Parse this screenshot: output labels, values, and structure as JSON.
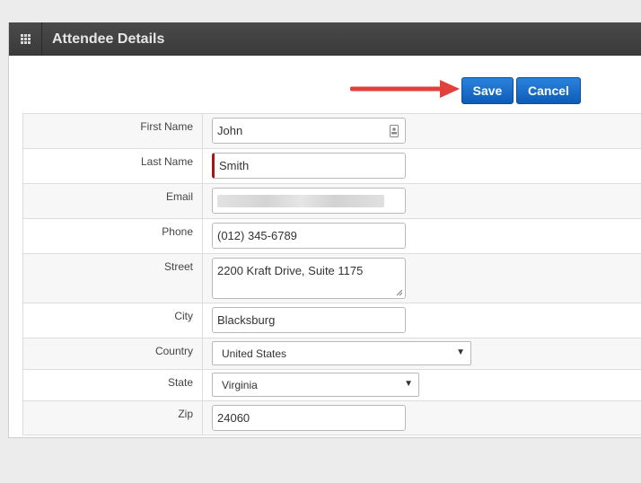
{
  "header": {
    "title": "Attendee Details",
    "icon": "grid-icon"
  },
  "actions": {
    "save_label": "Save",
    "cancel_label": "Cancel"
  },
  "fields": {
    "first_name": {
      "label": "First Name",
      "value": "John"
    },
    "last_name": {
      "label": "Last Name",
      "value": "Smith"
    },
    "email": {
      "label": "Email",
      "value": ""
    },
    "phone": {
      "label": "Phone",
      "value": "(012) 345-6789"
    },
    "street": {
      "label": "Street",
      "value": "2200 Kraft Drive, Suite 1175"
    },
    "city": {
      "label": "City",
      "value": "Blacksburg"
    },
    "country": {
      "label": "Country",
      "value": "United States"
    },
    "state": {
      "label": "State",
      "value": "Virginia"
    },
    "zip": {
      "label": "Zip",
      "value": "24060"
    }
  },
  "colors": {
    "header_bg": "#3f3f3f",
    "button_blue": "#1466c4",
    "arrow_red": "#e2403b",
    "required_marker": "#a3161a"
  }
}
